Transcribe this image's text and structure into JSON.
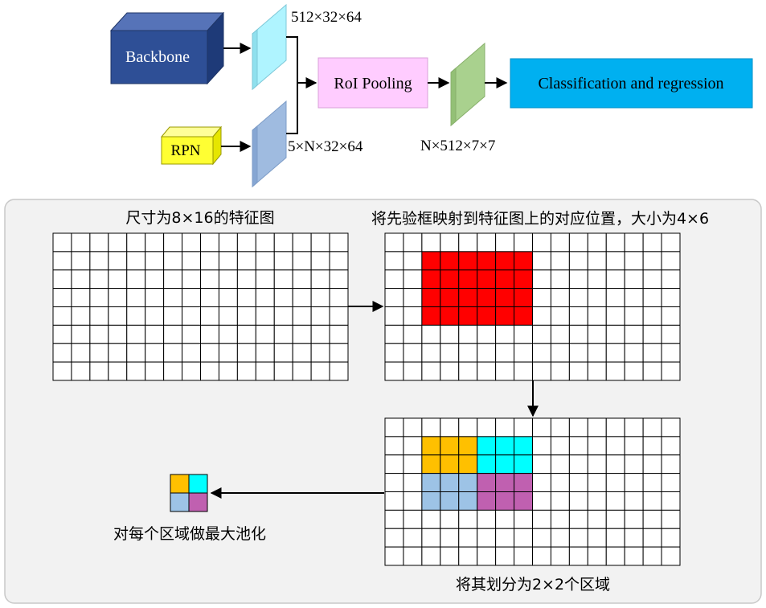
{
  "pipeline": {
    "backbone_label": "Backbone",
    "rpn_label": "RPN",
    "roi_pooling_label": "RoI Pooling",
    "classification_label": "Classification and regression",
    "backbone_feature_dims": "512×32×64",
    "rpn_proposal_dims": "5×N×32×64",
    "pooled_dims": "N×512×7×7"
  },
  "example": {
    "feature_map_caption": "尺寸为8×16的特征图",
    "mapping_caption": "将先验框映射到特征图上的对应位置，大小为4×6",
    "split_caption": "将其划分为2×2个区域",
    "maxpool_caption": "对每个区域做最大池化",
    "grid": {
      "rows": 8,
      "cols": 16
    },
    "roi": {
      "row": 1,
      "col": 2,
      "rows": 4,
      "cols": 6
    },
    "sub_regions": {
      "rows": 2,
      "cols": 2
    }
  },
  "colors": {
    "backbone": "#2e4f96",
    "rpn": "#ffff33",
    "roi_pooling": "#ffccff",
    "classification": "#00b0f0",
    "backbone_feature": "#aff4ff",
    "rpn_feature": "#9fbbe0",
    "pooled_feature": "#a9d18e",
    "roi_highlight": "#ff0000",
    "quadrant_top_left": "#ffc000",
    "quadrant_top_right": "#00ffff",
    "quadrant_bottom_left": "#9dc3e6",
    "quadrant_bottom_right": "#c060b0",
    "panel_background": "#f2f2f2"
  }
}
